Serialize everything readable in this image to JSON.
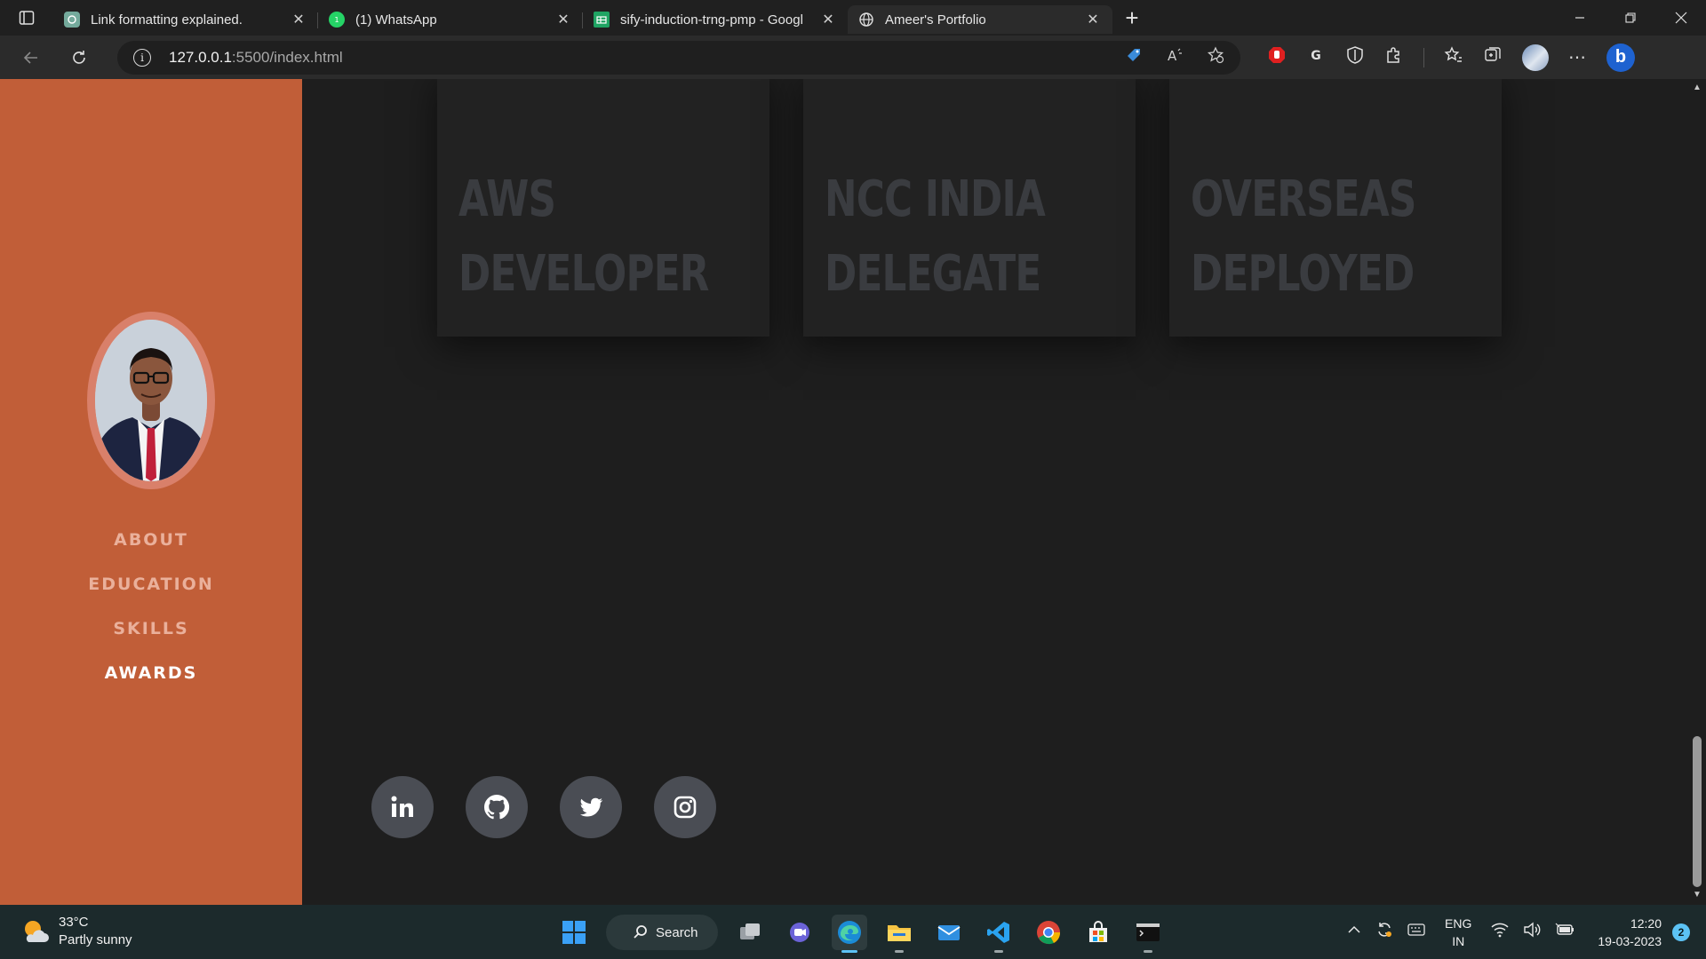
{
  "browser": {
    "tabs": [
      {
        "title": "Link formatting explained.",
        "icon": "chatgpt-icon",
        "active": false
      },
      {
        "title": "(1) WhatsApp",
        "icon": "whatsapp-icon",
        "active": false
      },
      {
        "title": "sify-induction-trng-pmp - Googl",
        "icon": "google-sheets-icon",
        "active": false
      },
      {
        "title": "Ameer's Portfolio",
        "icon": "globe-icon",
        "active": true
      }
    ],
    "close_glyph": "✕",
    "new_tab_glyph": "+",
    "url_host": "127.0.0.1",
    "url_path": ":5500/index.html"
  },
  "sidebar": {
    "avatar_alt": "profile photo",
    "nav": [
      {
        "label": "ABOUT",
        "active": false
      },
      {
        "label": "EDUCATION",
        "active": false
      },
      {
        "label": "SKILLS",
        "active": false
      },
      {
        "label": "AWARDS",
        "active": true
      }
    ]
  },
  "awards": {
    "cards": [
      {
        "line1": "AWS",
        "line2": "DEVELOPER"
      },
      {
        "line1": "NCC INDIA",
        "line2": "DELEGATE"
      },
      {
        "line1": "OVERSEAS",
        "line2": "DEPLOYED"
      }
    ]
  },
  "socials": [
    "linkedin-icon",
    "github-icon",
    "twitter-icon",
    "instagram-icon"
  ],
  "taskbar": {
    "weather_temp": "33°C",
    "weather_desc": "Partly sunny",
    "search_label": "Search",
    "lang_line1": "ENG",
    "lang_line2": "IN",
    "time": "12:20",
    "date": "19-03-2023",
    "notification_count": "2"
  },
  "colors": {
    "sidebar": "#c15e38",
    "nav_inactive": "#eab09b",
    "nav_active": "#ffffff",
    "page_bg": "#1e1e1e",
    "card_bg": "#222222",
    "card_text": "#3a3c40",
    "social_bg": "#4a4d54"
  }
}
